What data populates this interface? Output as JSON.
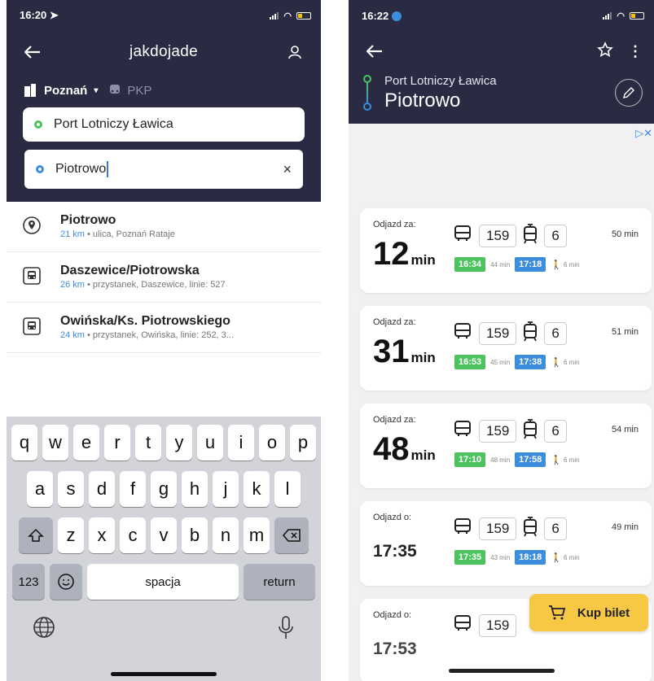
{
  "left": {
    "status": {
      "time": "16:20"
    },
    "header": {
      "title": "jakdojade"
    },
    "city": {
      "name": "Poznań",
      "pkp": "PKP"
    },
    "from_field": {
      "value": "Port Lotniczy Ławica"
    },
    "to_field": {
      "value": "Piotrowo",
      "clear": "×"
    },
    "results": [
      {
        "title": "Piotrowo",
        "km": "21 km",
        "sub": " • ulica, Poznań Rataje",
        "icon": "location-pin-icon"
      },
      {
        "title": "Daszewice/Piotrowska",
        "km": "26 km",
        "sub": " • przystanek, Daszewice, linie: 527",
        "icon": "bus-stop-icon"
      },
      {
        "title": "Owińska/Ks. Piotrowskiego",
        "km": "24 km",
        "sub": " • przystanek, Owińska, linie: 252, 3...",
        "icon": "bus-stop-icon"
      }
    ],
    "keyboard": {
      "row1": [
        "q",
        "w",
        "e",
        "r",
        "t",
        "y",
        "u",
        "i",
        "o",
        "p"
      ],
      "row2": [
        "a",
        "s",
        "d",
        "f",
        "g",
        "h",
        "j",
        "k",
        "l"
      ],
      "row3": [
        "z",
        "x",
        "c",
        "v",
        "b",
        "n",
        "m"
      ],
      "numbers": "123",
      "space": "spacja",
      "return": "return"
    }
  },
  "right": {
    "status": {
      "time": "16:22"
    },
    "route": {
      "from": "Port Lotniczy Ławica",
      "to": "Piotrowo"
    },
    "trips": [
      {
        "label": "Odjazd za:",
        "value": "12",
        "unit": "min",
        "line1": "159",
        "line2": "6",
        "duration": "50 min",
        "t1": "16:34",
        "gap": "44 min",
        "t2": "17:18",
        "walk": "6 min"
      },
      {
        "label": "Odjazd za:",
        "value": "31",
        "unit": "min",
        "line1": "159",
        "line2": "6",
        "duration": "51 min",
        "t1": "16:53",
        "gap": "45 min",
        "t2": "17:38",
        "walk": "6 min"
      },
      {
        "label": "Odjazd za:",
        "value": "48",
        "unit": "min",
        "line1": "159",
        "line2": "6",
        "duration": "54 min",
        "t1": "17:10",
        "gap": "48 min",
        "t2": "17:58",
        "walk": "6 min"
      },
      {
        "label": "Odjazd o:",
        "clock": "17:35",
        "line1": "159",
        "line2": "6",
        "duration": "49 min",
        "t1": "17:35",
        "gap": "43 min",
        "t2": "18:18",
        "walk": "6 min"
      },
      {
        "label": "Odjazd o:",
        "clock": "17:53",
        "line1": "159"
      }
    ],
    "buy_button": {
      "label": "Kup bilet"
    }
  },
  "colors": {
    "header": "#2b2a43",
    "green": "#4cc35e",
    "blue": "#3c8ddb",
    "yellow": "#f6c844"
  }
}
